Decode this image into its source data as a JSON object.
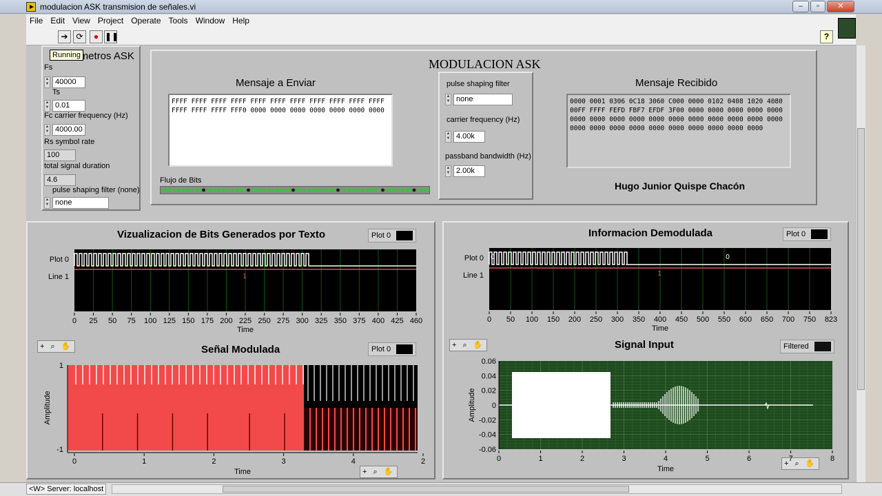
{
  "window": {
    "title": "modulacion ASK transmision de señales.vi",
    "controls": [
      "–",
      "▫",
      "✕"
    ]
  },
  "menu": [
    "File",
    "Edit",
    "View",
    "Project",
    "Operate",
    "Tools",
    "Window",
    "Help"
  ],
  "toolbar": {
    "tooltip": "Running",
    "help": "?"
  },
  "params": {
    "title": "Parametros ASK",
    "fs_label": "Fs",
    "fs": "40000",
    "ts_label": "Ts",
    "ts": "0.01",
    "fc_label": "Fc carrier frequency (Hz)",
    "fc": "4000.00",
    "rs_label": "Rs symbol rate",
    "rs": "100",
    "dur_label": "total signal duration",
    "dur": "4.6",
    "psf_label": "pulse shaping filter (none)",
    "psf": "none"
  },
  "main": {
    "title": "MODULACION ASK",
    "msg_send_label": "Mensaje a Enviar",
    "msg_send": "FFFF FFFF FFFF FFFF FFFF FFFF FFFF FFFF FFFF FFFF FFFF FFFF FFFF FFFF FFF0 0000 0000 0000 0000 0000 0000 0000",
    "bits_label": "Flujo de Bits",
    "psf_label": "pulse shaping filter",
    "psf": "none",
    "carrier_label": "carrier frequency (Hz)",
    "carrier": "4.00k",
    "bw_label": "passband bandwidth (Hz)",
    "bw": "2.00k",
    "msg_recv_label": "Mensaje Recibido",
    "msg_recv": "0000 0001 0306 0C18 3060 C000 0000 0102 0408 1020 4080 00FF FFFF FEFD FBF7 EFDF 3F00 0000 0000 0000 0000 0000 0000 0000 0000 0000 0000 0000 0000 0000 0000 0000 0000 0000 0000 0000 0000 0000 0000 0000 0000 0000 0000",
    "author": "Hugo Junior Quispe Chacón"
  },
  "charts": {
    "bits": {
      "title": "Vizualizacion de Bits Generados por Texto",
      "legend": "Plot 0",
      "row1": "Plot 0",
      "row2": "Line 1",
      "xlabel": "Time"
    },
    "demod": {
      "title": "Informacion Demodulada",
      "legend": "Plot 0",
      "row1": "Plot 0",
      "row2": "Line 1",
      "xlabel": "Time"
    },
    "mod": {
      "title": "Señal Modulada",
      "legend": "Plot 0",
      "xlabel": "Time",
      "ylabel": "Amplitude"
    },
    "input": {
      "title": "Signal Input",
      "legend": "Filtered",
      "xlabel": "Time",
      "ylabel": "Amplitude"
    },
    "toolbox": "+ ⌕ ✋"
  },
  "chart_data": [
    {
      "type": "line",
      "title": "Vizualizacion de Bits Generados por Texto",
      "xlabel": "Time",
      "xlim": [
        0,
        460
      ],
      "xticks": [
        "0",
        "25",
        "50",
        "75",
        "100",
        "125",
        "150",
        "175",
        "200",
        "225",
        "250",
        "275",
        "300",
        "325",
        "350",
        "375",
        "400",
        "425",
        "460"
      ],
      "series": [
        {
          "name": "Plot 0"
        },
        {
          "name": "Line 1",
          "label": "1"
        }
      ]
    },
    {
      "type": "line",
      "title": "Informacion Demodulada",
      "xlabel": "Time",
      "xlim": [
        0,
        823
      ],
      "xticks": [
        "0",
        "50",
        "100",
        "150",
        "200",
        "250",
        "300",
        "350",
        "400",
        "450",
        "500",
        "550",
        "600",
        "650",
        "700",
        "750",
        "823"
      ],
      "series": [
        {
          "name": "Plot 0",
          "labels": [
            "0",
            "0"
          ]
        },
        {
          "name": "Line 1",
          "label": "1"
        }
      ]
    },
    {
      "type": "line",
      "title": "Señal Modulada",
      "xlabel": "Time",
      "ylabel": "Amplitude",
      "xlim": [
        0,
        2
      ],
      "ylim": [
        -1,
        1
      ],
      "xticks": [
        "0",
        "1",
        "2",
        "3",
        "4",
        "2"
      ],
      "yticks": [
        "1",
        "-1"
      ],
      "series": [
        {
          "name": "Plot 0"
        }
      ]
    },
    {
      "type": "line",
      "title": "Signal Input",
      "xlabel": "Time",
      "ylabel": "Amplitude",
      "xlim": [
        0,
        8
      ],
      "ylim": [
        -0.06,
        0.06
      ],
      "xticks": [
        "0",
        "1",
        "2",
        "3",
        "4",
        "5",
        "6",
        "7",
        "8"
      ],
      "yticks": [
        "0.06",
        "0.04",
        "0.02",
        "0",
        "-0.02",
        "-0.04",
        "-0.06"
      ],
      "series": [
        {
          "name": "Filtered"
        }
      ]
    }
  ],
  "status": {
    "server": "<W> Server: localhost"
  }
}
